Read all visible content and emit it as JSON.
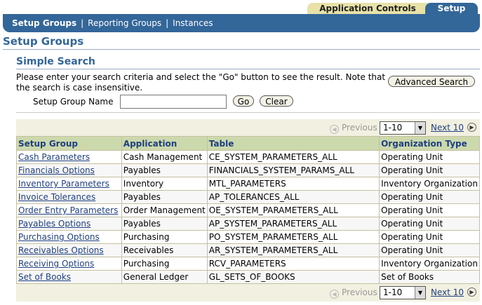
{
  "tabs": {
    "application_controls": "Application Controls",
    "setup": "Setup"
  },
  "nav": {
    "setup_groups": "Setup Groups",
    "reporting_groups": "Reporting Groups",
    "instances": "Instances",
    "separator": "|"
  },
  "page_title": "Setup Groups",
  "search": {
    "title": "Simple Search",
    "instructions": "Please enter your search criteria and select the \"Go\" button to see the result. Note that the search is case insensitive.",
    "advanced_label": "Advanced Search",
    "field_label": "Setup Group Name",
    "field_value": "",
    "go_label": "Go",
    "clear_label": "Clear"
  },
  "pager": {
    "previous": "Previous",
    "range": "1-10",
    "next": "Next 10"
  },
  "table": {
    "columns": [
      "Setup Group",
      "Application",
      "Table",
      "Organization Type"
    ],
    "rows": [
      [
        "Cash Parameters",
        "Cash Management",
        "CE_SYSTEM_PARAMETERS_ALL",
        "Operating Unit"
      ],
      [
        "Financials Options",
        "Payables",
        "FINANCIALS_SYSTEM_PARAMS_ALL",
        "Operating Unit"
      ],
      [
        "Inventory Parameters",
        "Inventory",
        "MTL_PARAMETERS",
        "Inventory Organization"
      ],
      [
        "Invoice Tolerances",
        "Payables",
        "AP_TOLERANCES_ALL",
        "Operating Unit"
      ],
      [
        "Order Entry Parameters",
        "Order Management",
        "OE_SYSTEM_PARAMETERS_ALL",
        "Operating Unit"
      ],
      [
        "Payables Options",
        "Payables",
        "AP_SYSTEM_PARAMETERS_ALL",
        "Operating Unit"
      ],
      [
        "Purchasing Options",
        "Purchasing",
        "PO_SYSTEM_PARAMETERS_ALL",
        "Operating Unit"
      ],
      [
        "Receivables Options",
        "Receivables",
        "AR_SYSTEM_PARAMETERS_ALL",
        "Operating Unit"
      ],
      [
        "Receiving Options",
        "Purchasing",
        "RCV_PARAMETERS",
        "Inventory Organization"
      ],
      [
        "Set of Books",
        "General Ledger",
        "GL_SETS_OF_BOOKS",
        "Set of Books"
      ]
    ]
  }
}
